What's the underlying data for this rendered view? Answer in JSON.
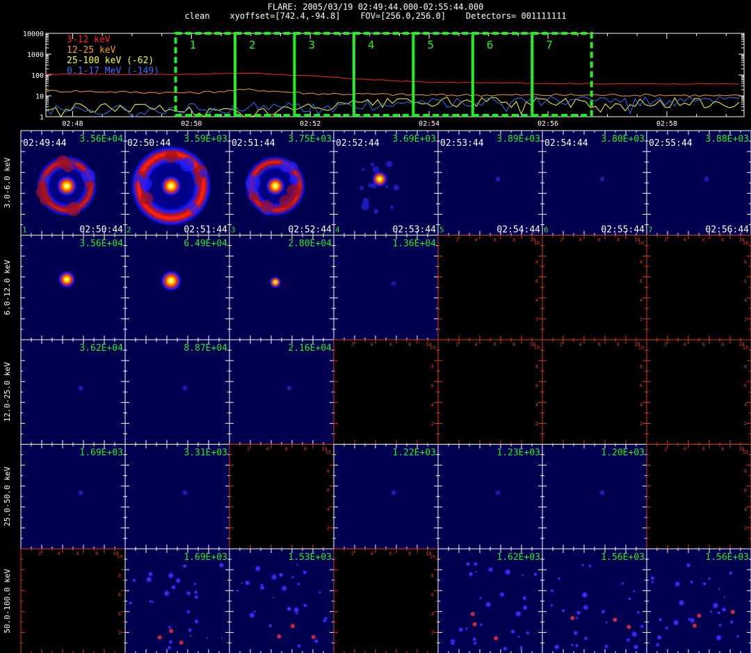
{
  "header": {
    "line1": "FLARE: 2005/03/19 02:49:44.000-02:55:44.000",
    "line2": "clean    xyoffset=[742.4,-94.8]    FOV=[256.0,256.0]    Detectors= 001111111"
  },
  "chart_data": [
    {
      "type": "line",
      "yscale": "log",
      "ylim": [
        1,
        10000
      ],
      "ytick_labels": [
        "1",
        "10",
        "100",
        "1000",
        "10000"
      ],
      "xtick_labels": [
        "02:48",
        "02:50",
        "02:52",
        "02:54",
        "02:56",
        "02:58"
      ],
      "legend_placement": "top-left",
      "series": [
        {
          "name": "3-12 keV",
          "color": "#ff2020",
          "x": [
            "02:48",
            "02:49",
            "02:50",
            "02:51",
            "02:52",
            "02:53",
            "02:54",
            "02:55",
            "02:56",
            "02:57",
            "02:58",
            "02:59"
          ],
          "values": [
            110,
            105,
            110,
            125,
            90,
            60,
            45,
            42,
            40,
            38,
            38,
            38
          ]
        },
        {
          "name": "12-25 keV",
          "color": "#ff9a20",
          "x": [
            "02:48",
            "02:49",
            "02:50",
            "02:51",
            "02:52",
            "02:53",
            "02:54",
            "02:55",
            "02:56",
            "02:57",
            "02:58",
            "02:59"
          ],
          "values": [
            17,
            15,
            14,
            20,
            13,
            12,
            11,
            11,
            11,
            11,
            11,
            10
          ]
        },
        {
          "name": "25-100 keV (-62)",
          "color": "#ffff30",
          "x": [
            "02:48",
            "02:49",
            "02:50",
            "02:51",
            "02:52",
            "02:53",
            "02:54",
            "02:55",
            "02:56",
            "02:57",
            "02:58",
            "02:59"
          ],
          "values": [
            2.5,
            3,
            2,
            1.5,
            2.5,
            4,
            5,
            5,
            5,
            4.5,
            4.5,
            4.5
          ]
        },
        {
          "name": "0.1-17 MeV (-149)",
          "color": "#3070ff",
          "x": [
            "02:48",
            "02:49",
            "02:50",
            "02:51",
            "02:52",
            "02:53",
            "02:54",
            "02:55",
            "02:56",
            "02:57",
            "02:58",
            "02:59"
          ],
          "values": [
            2.2,
            2.2,
            2.5,
            2.8,
            3,
            4,
            5,
            5.5,
            6,
            5.5,
            5.5,
            5.5
          ]
        }
      ],
      "intervals": [
        {
          "label": "1",
          "start": "02:49:44",
          "end": "02:50:44"
        },
        {
          "label": "2",
          "start": "02:50:44",
          "end": "02:51:44"
        },
        {
          "label": "3",
          "start": "02:51:44",
          "end": "02:52:44"
        },
        {
          "label": "4",
          "start": "02:52:44",
          "end": "02:53:44"
        },
        {
          "label": "5",
          "start": "02:53:44",
          "end": "02:54:44"
        },
        {
          "label": "6",
          "start": "02:54:44",
          "end": "02:55:44"
        },
        {
          "label": "7",
          "start": "02:55:44",
          "end": "02:56:44"
        }
      ]
    },
    {
      "type": "heatmap",
      "rows": [
        "3.0-6.0 keV",
        "6.0-12.0 keV",
        "12.0-25.0 keV",
        "25.0-50.0 keV",
        "50.0-100.0 keV"
      ],
      "columns": [
        {
          "index": "1",
          "start": "02:49:44",
          "end": "02:50:44"
        },
        {
          "index": "2",
          "start": "02:50:44",
          "end": "02:51:44"
        },
        {
          "index": "3",
          "start": "02:51:44",
          "end": "02:52:44"
        },
        {
          "index": "4",
          "start": "02:52:44",
          "end": "02:53:44"
        },
        {
          "index": "5",
          "start": "02:53:44",
          "end": "02:54:44"
        },
        {
          "index": "6",
          "start": "02:54:44",
          "end": "02:55:44"
        },
        {
          "index": "7",
          "start": "02:55:44",
          "end": "02:56:44"
        }
      ],
      "axis_tick_labels": [
        "2",
        "4",
        "6",
        "8",
        "10"
      ],
      "cells": [
        [
          {
            "max": "3.56E+04",
            "kind": "ring",
            "ring": 0.6,
            "core": 1.0
          },
          {
            "max": "3.59E+03",
            "kind": "ring",
            "ring": 1.0,
            "core": 1.0
          },
          {
            "max": "3.75E+03",
            "kind": "ring",
            "ring": 0.75,
            "core": 0.8
          },
          {
            "max": "3.69E+03",
            "kind": "source",
            "ring": 0.1,
            "core": 0.6
          },
          {
            "max": "3.89E+03",
            "kind": "faint"
          },
          {
            "max": "3.80E+03",
            "kind": "faint"
          },
          {
            "max": "3.88E+03",
            "kind": "faint"
          }
        ],
        [
          {
            "max": "3.56E+04",
            "kind": "source",
            "core": 0.7
          },
          {
            "max": "6.49E+04",
            "kind": "source",
            "core": 1.0
          },
          {
            "max": "2.80E+04",
            "kind": "source",
            "core": 0.3
          },
          {
            "max": "1.36E+04",
            "kind": "faint"
          },
          {
            "max": "",
            "kind": "empty"
          },
          {
            "max": "",
            "kind": "empty"
          },
          {
            "max": "",
            "kind": "empty"
          }
        ],
        [
          {
            "max": "3.62E+04",
            "kind": "faint"
          },
          {
            "max": "8.87E+04",
            "kind": "faint"
          },
          {
            "max": "2.16E+04",
            "kind": "faint"
          },
          {
            "max": "",
            "kind": "empty"
          },
          {
            "max": "",
            "kind": "empty"
          },
          {
            "max": "",
            "kind": "empty"
          },
          {
            "max": "",
            "kind": "empty"
          }
        ],
        [
          {
            "max": "1.69E+03",
            "kind": "faint"
          },
          {
            "max": "3.31E+03",
            "kind": "faint"
          },
          {
            "max": "",
            "kind": "empty"
          },
          {
            "max": "1.22E+03",
            "kind": "faint"
          },
          {
            "max": "1.23E+03",
            "kind": "faint"
          },
          {
            "max": "1.20E+03",
            "kind": "faint"
          },
          {
            "max": "",
            "kind": "empty"
          }
        ],
        [
          {
            "max": "",
            "kind": "empty"
          },
          {
            "max": "1.69E+03",
            "kind": "noise"
          },
          {
            "max": "1.53E+03",
            "kind": "noise"
          },
          {
            "max": "",
            "kind": "empty"
          },
          {
            "max": "1.62E+03",
            "kind": "noise"
          },
          {
            "max": "1.56E+03",
            "kind": "noise"
          },
          {
            "max": "1.56E+03",
            "kind": "noise"
          }
        ]
      ]
    }
  ]
}
